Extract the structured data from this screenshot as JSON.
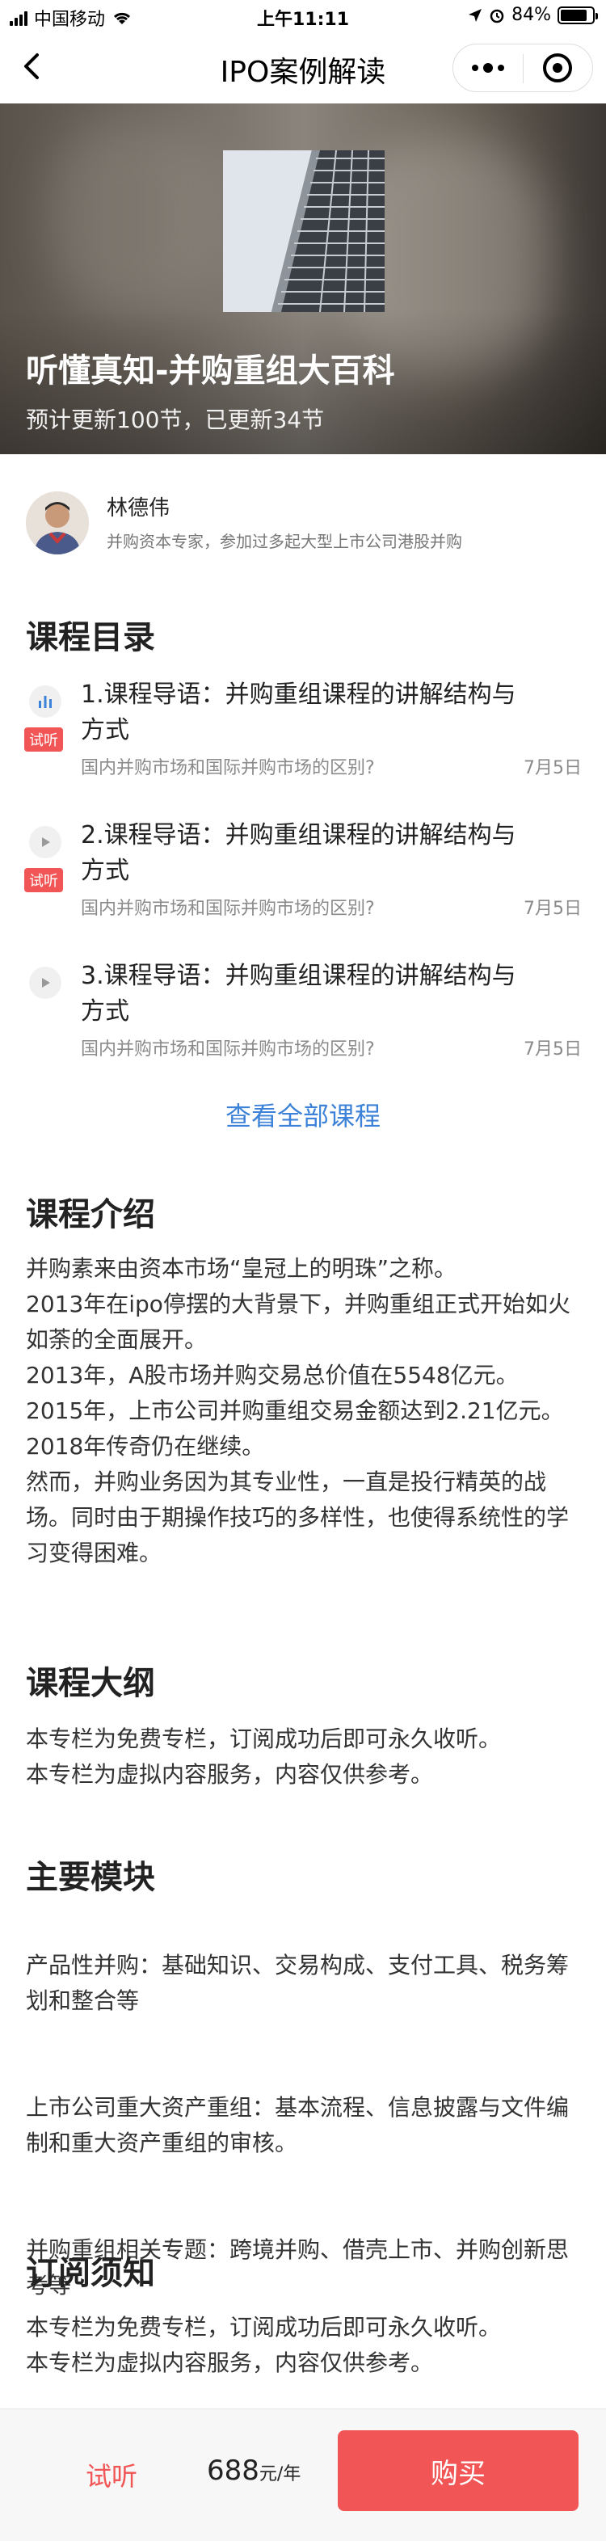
{
  "status_bar": {
    "carrier": "中国移动",
    "time": "上午11:11",
    "battery": "84%",
    "battery_level": 0.84
  },
  "nav": {
    "title": "IPO案例解读",
    "back_icon": "chevron-left-icon",
    "more_icon": "more-dots-icon",
    "close_icon": "target-close-icon"
  },
  "hero": {
    "title": "听懂真知-并购重组大百科",
    "subtitle": "预计更新100节，已更新34节"
  },
  "author": {
    "name": "林德伟",
    "description": "并购资本专家，参加过多起大型上市公司港股并购"
  },
  "catalog": {
    "title": "课程目录",
    "items": [
      {
        "title": "1.课程导语：并购重组课程的讲解结构与方式",
        "subtitle": "国内并购市场和国际并购市场的区别?",
        "date": "7月5日",
        "badge": "试听",
        "icon": "bars-icon"
      },
      {
        "title": "2.课程导语：并购重组课程的讲解结构与方式",
        "subtitle": "国内并购市场和国际并购市场的区别?",
        "date": "7月5日",
        "badge": "试听",
        "icon": "play-icon"
      },
      {
        "title": "3.课程导语：并购重组课程的讲解结构与方式",
        "subtitle": "国内并购市场和国际并购市场的区别?",
        "date": "7月5日",
        "badge": "",
        "icon": "play-icon"
      }
    ],
    "view_all": "查看全部课程"
  },
  "intro": {
    "title": "课程介绍",
    "text": "并购素来由资本市场“皇冠上的明珠”之称。\n2013年在ipo停摆的大背景下，并购重组正式开始如火如荼的全面展开。\n2013年，A股市场并购交易总价值在5548亿元。\n2015年，上市公司并购重组交易金额达到2.21亿元。\n2018年传奇仍在继续。\n然而，并购业务因为其专业性，一直是投行精英的战场。同时由于期操作技巧的多样性，也使得系统性的学习变得困难。"
  },
  "outline": {
    "title": "课程大纲",
    "text": "本专栏为免费专栏，订阅成功后即可永久收听。\n本专栏为虚拟内容服务，内容仅供参考。"
  },
  "modules": {
    "title": "主要模块",
    "items": [
      "产品性并购：基础知识、交易构成、支付工具、税务筹划和整合等",
      "上市公司重大资产重组：基本流程、信息披露与文件编制和重大资产重组的审核。",
      "并购重组相关专题：跨境并购、借壳上市、并购创新思考等"
    ]
  },
  "notice": {
    "title": "订阅须知",
    "text": "本专栏为免费专栏，订阅成功后即可永久收听。\n本专栏为虚拟内容服务，内容仅供参考。"
  },
  "bottom": {
    "trial": "试听",
    "price": "688",
    "unit": "元/年",
    "buy": "购买"
  },
  "colors": {
    "accent_red": "#f25555",
    "link_blue": "#3b82d8"
  }
}
